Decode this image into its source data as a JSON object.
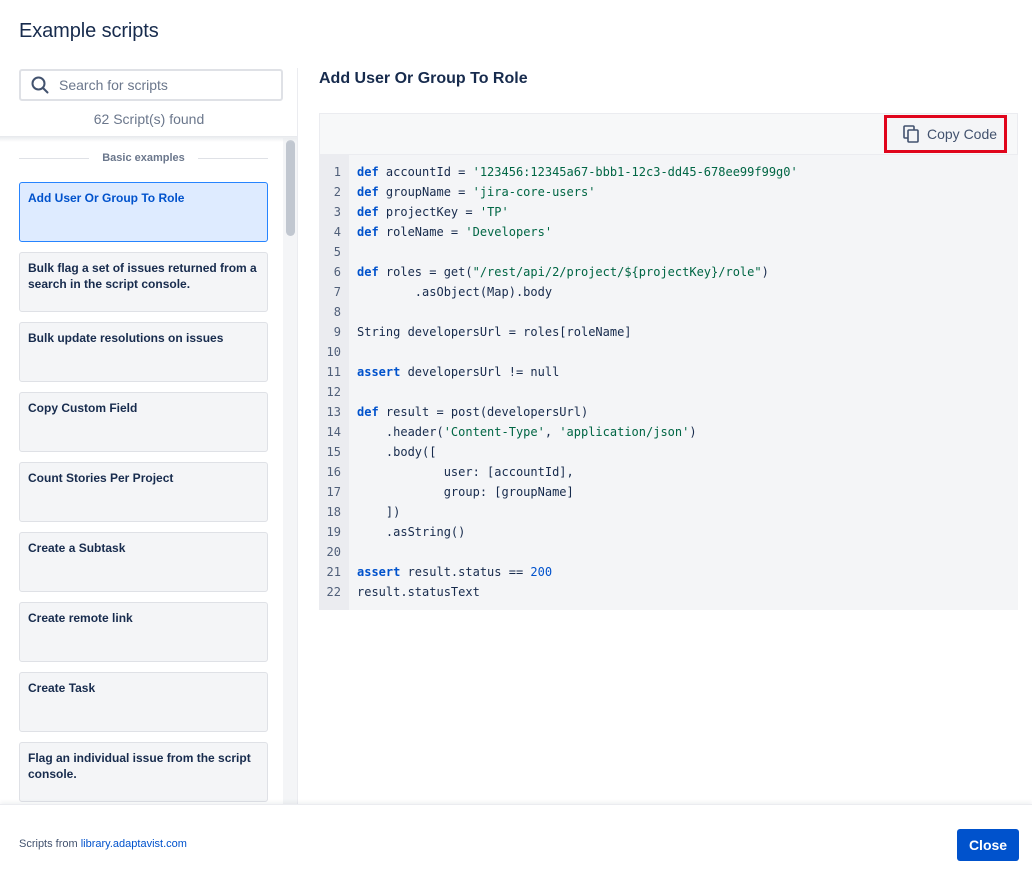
{
  "modal": {
    "title": "Example scripts"
  },
  "search": {
    "placeholder": "Search for scripts",
    "value": ""
  },
  "results": {
    "count_text": "62 Script(s) found"
  },
  "section": {
    "label": "Basic examples"
  },
  "scripts": [
    {
      "label": "Add User Or Group To Role",
      "selected": true
    },
    {
      "label": "Bulk flag a set of issues returned from a search in the script console."
    },
    {
      "label": "Bulk update resolutions on issues"
    },
    {
      "label": "Copy Custom Field"
    },
    {
      "label": "Count Stories Per Project"
    },
    {
      "label": "Create a Subtask"
    },
    {
      "label": "Create remote link"
    },
    {
      "label": "Create Task"
    },
    {
      "label": "Flag an individual issue from the script console."
    }
  ],
  "detail": {
    "title": "Add User Or Group To Role",
    "copy_label": "Copy Code"
  },
  "code": {
    "lines": [
      "1",
      "2",
      "3",
      "4",
      "5",
      "6",
      "7",
      "8",
      "9",
      "10",
      "11",
      "12",
      "13",
      "14",
      "15",
      "16",
      "17",
      "18",
      "19",
      "20",
      "21",
      "22"
    ],
    "l1": {
      "kw": "def",
      "rest": " accountId = ",
      "str": "'123456:12345a67-bbb1-12c3-dd45-678ee99f99g0'"
    },
    "l2": {
      "kw": "def",
      "rest": " groupName = ",
      "str": "'jira-core-users'"
    },
    "l3": {
      "kw": "def",
      "rest": " projectKey = ",
      "str": "'TP'"
    },
    "l4": {
      "kw": "def",
      "rest": " roleName = ",
      "str": "'Developers'"
    },
    "l6": {
      "kw": "def",
      "rest": " roles = get(",
      "str": "\"/rest/api/2/project/${projectKey}/role\"",
      "end": ")"
    },
    "l7": "        .asObject(Map).body",
    "l9": "String developersUrl = roles[roleName]",
    "l11": {
      "kw": "assert",
      "rest": " developersUrl != null"
    },
    "l13": {
      "kw": "def",
      "rest": " result = post(developersUrl)"
    },
    "l14": {
      "pre": "    .header(",
      "s1": "'Content-Type'",
      "mid": ", ",
      "s2": "'application/json'",
      "end": ")"
    },
    "l15": "    .body([",
    "l16": "            user: [accountId],",
    "l17": "            group: [groupName]",
    "l18": "    ])",
    "l19": "    .asString()",
    "l21": {
      "kw": "assert",
      "rest": " result.status == ",
      "num": "200"
    },
    "l22": "result.statusText"
  },
  "footer": {
    "prefix": "Scripts from ",
    "link": "library.adaptavist.com",
    "close_label": "Close"
  },
  "colors": {
    "accent": "#0052cc",
    "highlight_border": "#e0051c",
    "selected_bg": "#deebff"
  }
}
